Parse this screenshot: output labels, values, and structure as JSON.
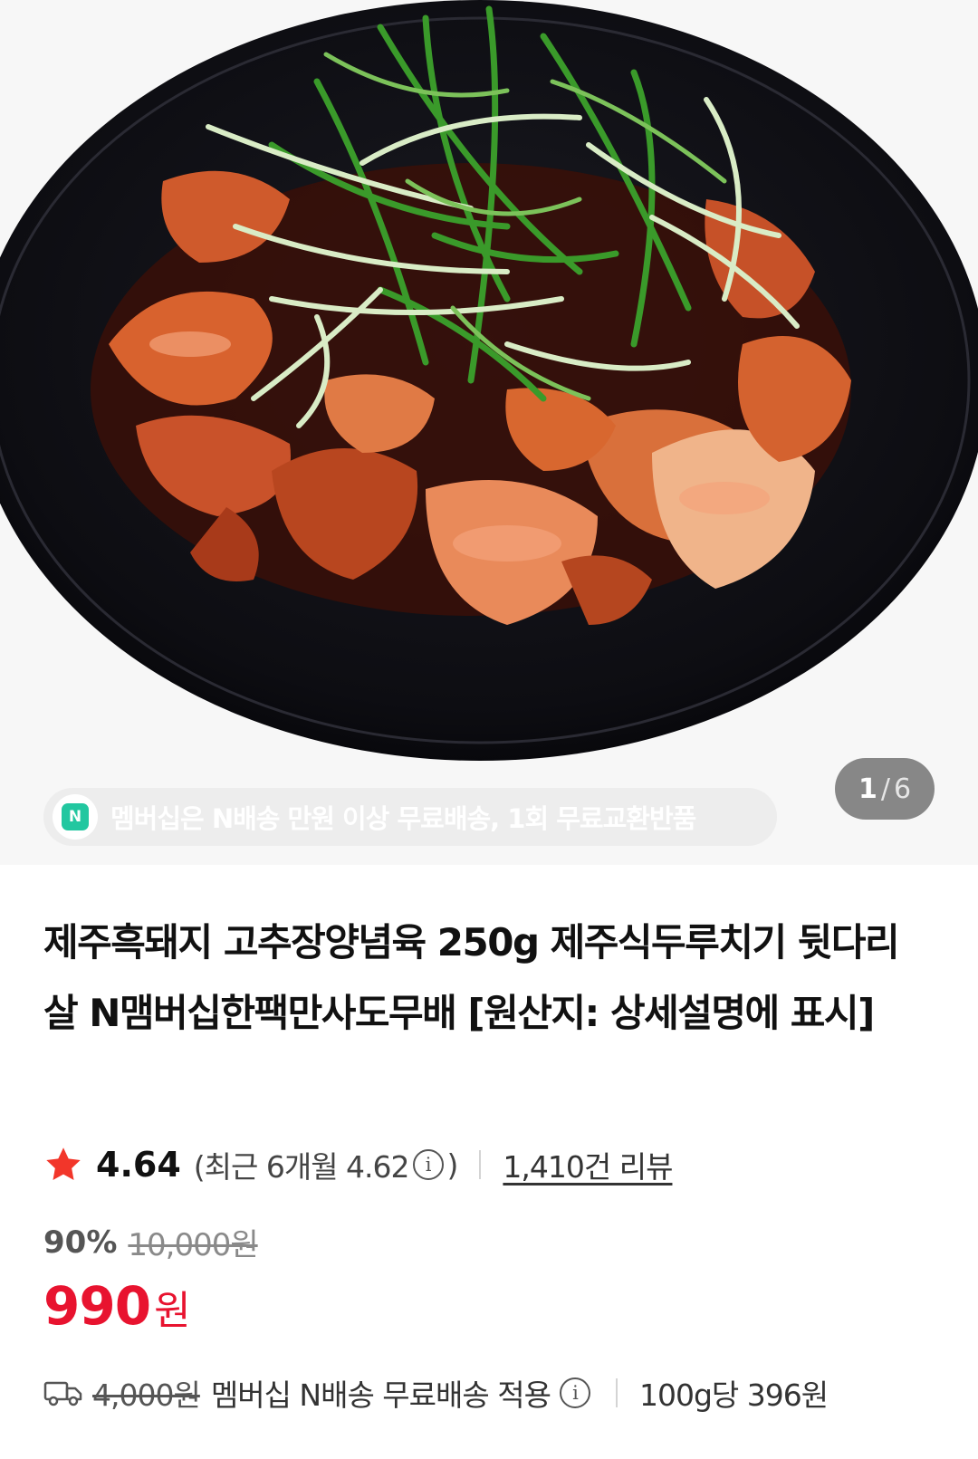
{
  "carousel": {
    "current": "1",
    "separator": "/",
    "total": "6",
    "banner_badge": "N",
    "banner_text": "멤버십은 N배송 만원 이상 무료배송, 1회 무료교환반품"
  },
  "product": {
    "title": "제주흑돼지 고추장양념육 250g 제주식두루치기 뒷다리살 N맴버십한팩만사도무배 [원산지: 상세설명에 표시]",
    "rating": "4.64",
    "recent_rating_prefix": "(최근 6개월 4.62",
    "recent_rating_suffix": ")",
    "info_icon": "i",
    "review_count": "1,410건 리뷰",
    "discount_rate": "90%",
    "original_price": "10,000원",
    "price": "990",
    "price_unit": "원"
  },
  "shipping": {
    "original_fee": "4,000원",
    "description": "멤버십 N배송 무료배송 적용",
    "unit_price": "100g당 396원"
  },
  "colors": {
    "price_red": "#e8132f",
    "star": "#f2362a",
    "membership_green": "#22c7a0"
  }
}
